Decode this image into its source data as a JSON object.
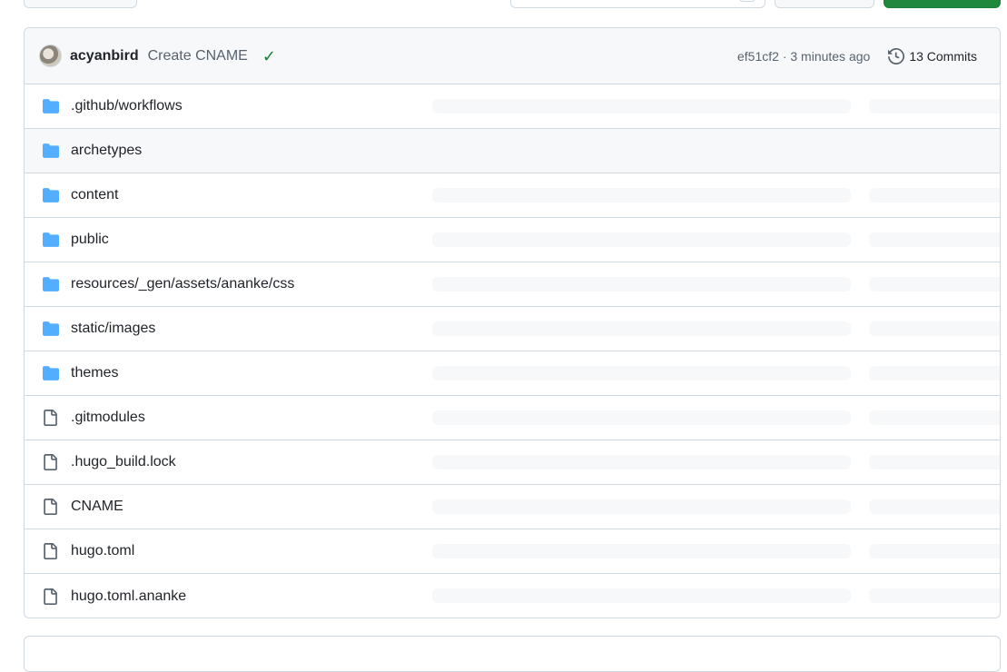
{
  "commit": {
    "author": "acyanbird",
    "message": "Create CNAME",
    "status": "✓",
    "sha_time": "ef51cf2 · 3 minutes ago",
    "commits_label": "13 Commits"
  },
  "files": [
    {
      "name": ".github/workflows",
      "type": "folder"
    },
    {
      "name": "archetypes",
      "type": "folder"
    },
    {
      "name": "content",
      "type": "folder"
    },
    {
      "name": "public",
      "type": "folder"
    },
    {
      "name": "resources/_gen/assets/ananke/css",
      "type": "folder"
    },
    {
      "name": "static/images",
      "type": "folder"
    },
    {
      "name": "themes",
      "type": "folder"
    },
    {
      "name": ".gitmodules",
      "type": "file"
    },
    {
      "name": ".hugo_build.lock",
      "type": "file"
    },
    {
      "name": "CNAME",
      "type": "file"
    },
    {
      "name": "hugo.toml",
      "type": "file"
    },
    {
      "name": "hugo.toml.ananke",
      "type": "file"
    }
  ],
  "colors": {
    "folder": "#54aeff",
    "file": "#59636e",
    "success": "#1a7f37",
    "primary_button": "#1f883d"
  },
  "icons": {
    "folder": "file-directory-icon",
    "file": "file-icon",
    "history": "history-icon",
    "check": "check-icon"
  }
}
